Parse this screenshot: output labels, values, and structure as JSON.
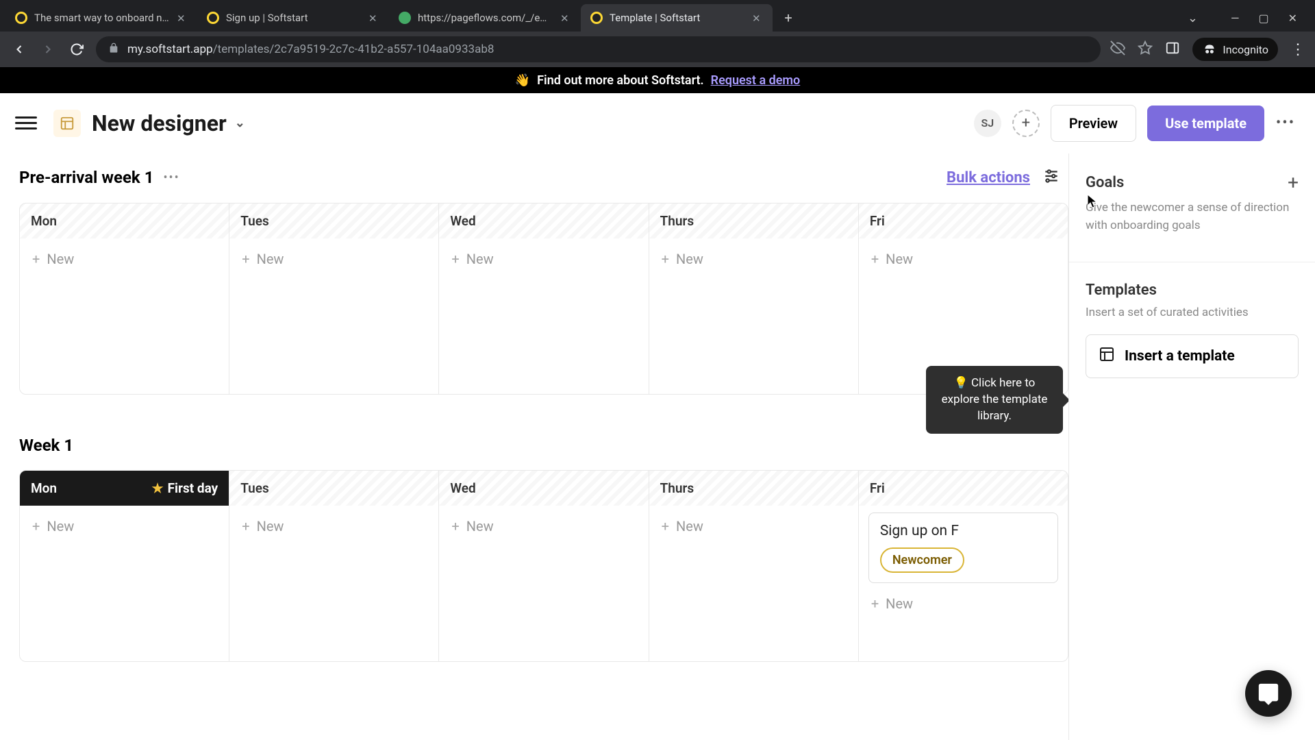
{
  "browser": {
    "tabs": [
      {
        "title": "The smart way to onboard new h",
        "active": false
      },
      {
        "title": "Sign up | Softstart",
        "active": false
      },
      {
        "title": "https://pageflows.com/_/emails/",
        "active": false
      },
      {
        "title": "Template | Softstart",
        "active": true
      }
    ],
    "url_host": "my.softstart.app",
    "url_path": "/templates/2c7a9519-2c7c-41b2-a557-104aa0933ab8",
    "incognito": "Incognito"
  },
  "announce": {
    "emoji": "👋",
    "text": "Find out more about Softstart.",
    "link": "Request a demo"
  },
  "header": {
    "title": "New designer",
    "avatar_initials": "SJ",
    "preview": "Preview",
    "use_template": "Use template"
  },
  "board": {
    "bulk_actions": "Bulk actions",
    "new_label": "New",
    "weeks": [
      {
        "title": "Pre-arrival week 1",
        "show_actions": true,
        "days": [
          {
            "name": "Mon",
            "first_day": false,
            "cards": []
          },
          {
            "name": "Tues",
            "first_day": false,
            "cards": []
          },
          {
            "name": "Wed",
            "first_day": false,
            "cards": []
          },
          {
            "name": "Thurs",
            "first_day": false,
            "cards": []
          },
          {
            "name": "Fri",
            "first_day": false,
            "cards": []
          }
        ]
      },
      {
        "title": "Week 1",
        "show_actions": false,
        "days": [
          {
            "name": "Mon",
            "first_day": true,
            "first_day_label": "First day",
            "cards": []
          },
          {
            "name": "Tues",
            "first_day": false,
            "cards": []
          },
          {
            "name": "Wed",
            "first_day": false,
            "cards": []
          },
          {
            "name": "Thurs",
            "first_day": false,
            "cards": []
          },
          {
            "name": "Fri",
            "first_day": false,
            "cards": [
              {
                "title": "Sign up on F",
                "tag": "Newcomer"
              }
            ]
          }
        ]
      }
    ],
    "tooltip": "💡 Click here to explore the template library."
  },
  "sidebar": {
    "goals_title": "Goals",
    "goals_desc": "Give the newcomer a sense of direction with onboarding goals",
    "templates_title": "Templates",
    "templates_desc": "Insert a set of curated activities",
    "insert_label": "Insert a template"
  }
}
